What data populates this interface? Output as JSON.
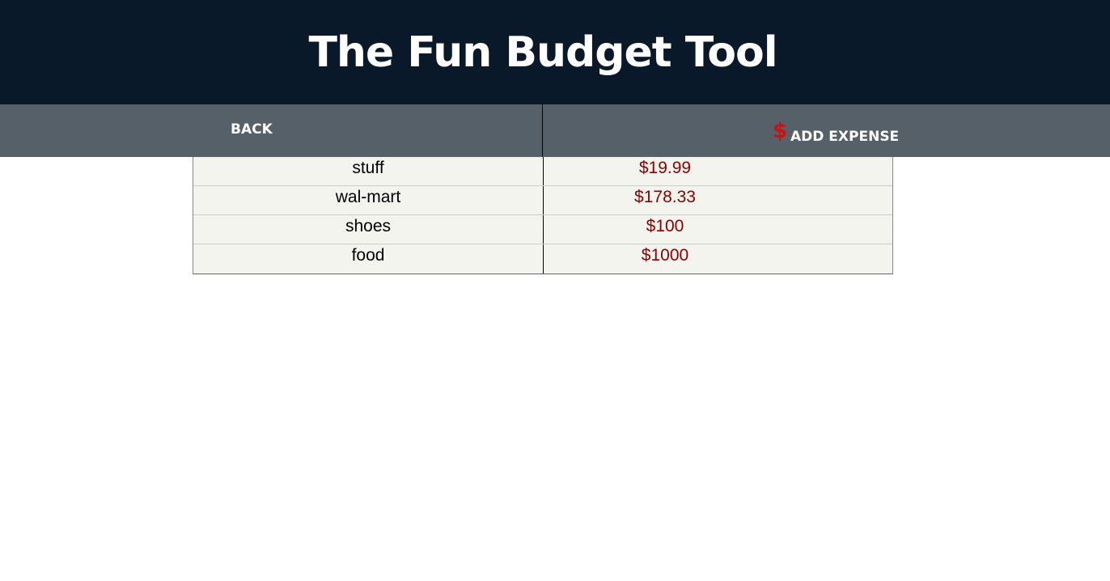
{
  "header": {
    "title": "The Fun Budget Tool"
  },
  "nav": {
    "back_label": "BACK",
    "add_icon": "dollar-icon",
    "add_icon_glyph": "$",
    "add_label": "ADD EXPENSE"
  },
  "colors": {
    "header_bg": "#0a1929",
    "nav_bg": "#556069",
    "accent_red": "#d01010",
    "amount_red": "#8b0000",
    "table_bg": "#f3f4ee"
  },
  "expenses": [
    {
      "name": "stuff",
      "amount": "$19.99"
    },
    {
      "name": "wal-mart",
      "amount": "$178.33"
    },
    {
      "name": "shoes",
      "amount": "$100"
    },
    {
      "name": "food",
      "amount": "$1000"
    }
  ]
}
